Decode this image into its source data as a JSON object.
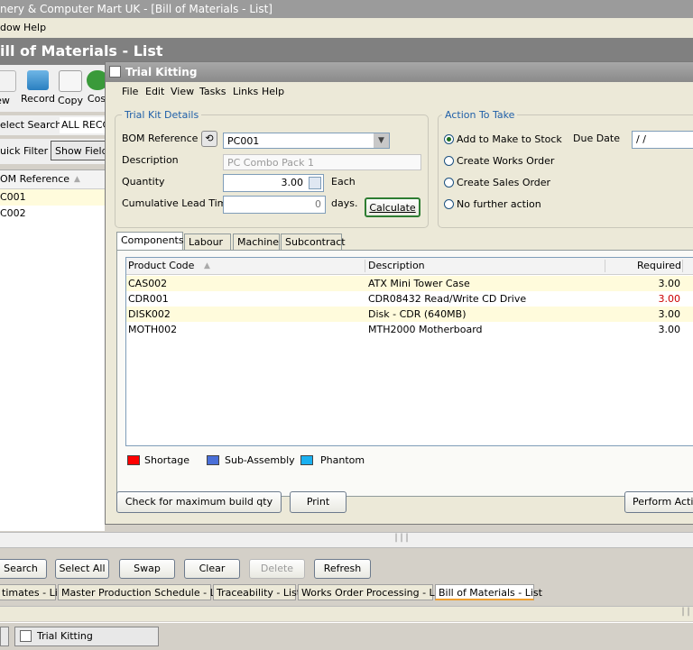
{
  "app": {
    "title": "nery & Computer Mart UK - [Bill of Materials - List]",
    "menu": [
      "dow",
      "Help"
    ],
    "header": "ill of Materials - List"
  },
  "toolbar": {
    "items": [
      "ew",
      "Record",
      "Copy",
      "Cos"
    ],
    "select_search_label": "elect Search",
    "select_search_value": "ALL RECC",
    "quick_filter_label": "uick Filter",
    "show_fields_label": "Show Fields"
  },
  "bom_list": {
    "column": "OM Reference",
    "rows": [
      "C001",
      "C002"
    ]
  },
  "dialog": {
    "title": "Trial Kitting",
    "menu": [
      "File",
      "Edit",
      "View",
      "Tasks",
      "Links",
      "Help"
    ],
    "trial_kit_details": {
      "legend": "Trial Kit Details",
      "bom_reference_label": "BOM Reference",
      "bom_reference_value": "PC001",
      "description_label": "Description",
      "description_value": "PC Combo Pack 1",
      "quantity_label": "Quantity",
      "quantity_value": "3.00",
      "quantity_unit": "Each",
      "lead_time_label": "Cumulative Lead Time",
      "lead_time_value": "0",
      "lead_time_unit": "days.",
      "calculate_label": "Calculate"
    },
    "action": {
      "legend": "Action To Take",
      "options": [
        "Add to Make to Stock",
        "Create Works Order",
        "Create Sales Order",
        "No further action"
      ],
      "selected_index": 0,
      "due_date_label": "Due Date",
      "due_date_value": " / /"
    },
    "tabs": [
      "Components",
      "Labour",
      "Machine",
      "Subcontract"
    ],
    "grid": {
      "headers": [
        "Product Code",
        "Description",
        "Required"
      ],
      "rows": [
        {
          "code": "CAS002",
          "description": "ATX Mini Tower Case",
          "required": "3.00",
          "color": "#000000"
        },
        {
          "code": "CDR001",
          "description": "CDR08432 Read/Write CD Drive",
          "required": "3.00",
          "color": "#cc0000"
        },
        {
          "code": "DISK002",
          "description": "Disk - CDR (640MB)",
          "required": "3.00",
          "color": "#000000"
        },
        {
          "code": "MOTH002",
          "description": "MTH2000 Motherboard",
          "required": "3.00",
          "color": "#000000"
        }
      ]
    },
    "legend_items": [
      {
        "label": "Shortage",
        "color": "#ff0000"
      },
      {
        "label": "Sub-Assembly",
        "color": "#4a6fd8"
      },
      {
        "label": "Phantom",
        "color": "#1ab0f0"
      }
    ],
    "buttons": {
      "max_build": "Check for maximum build qty",
      "print": "Print",
      "perform": "Perform Action"
    }
  },
  "bottom_buttons": [
    "Search",
    "Select All",
    "Swap",
    "Clear",
    "Delete",
    "Refresh"
  ],
  "bottom_tabs": [
    "timates - List",
    "Master Production Schedule - List",
    "Traceability - List",
    "Works Order Processing - List",
    "Bill of Materials - List"
  ],
  "taskbar": {
    "item": "Trial Kitting"
  }
}
